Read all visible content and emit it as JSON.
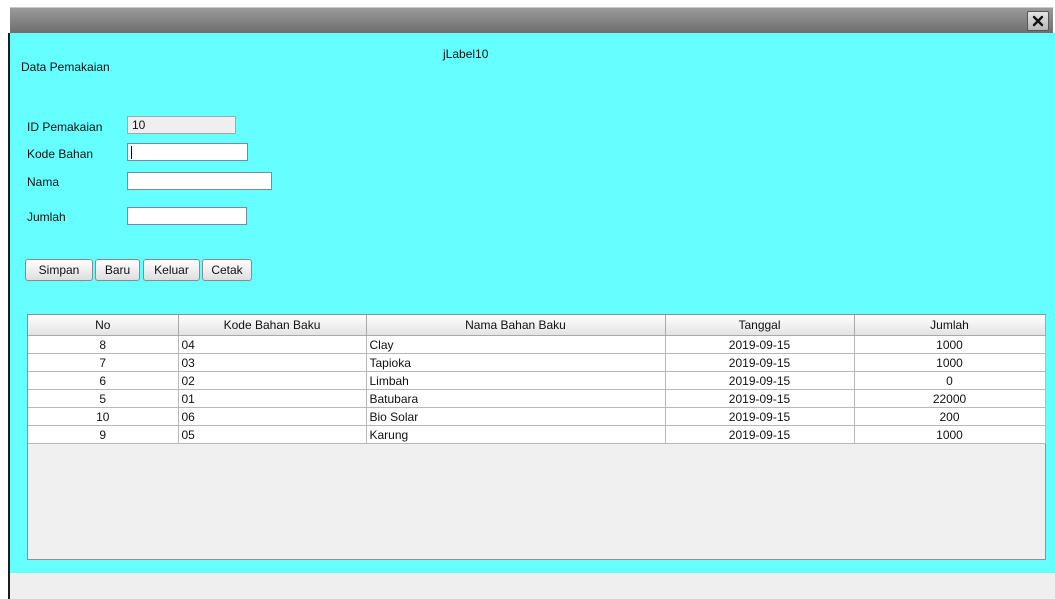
{
  "window": {
    "close_icon": "close-icon"
  },
  "header": {
    "title": "Data Pemakaian",
    "top_label": "jLabel10"
  },
  "form": {
    "id_label": "ID Pemakaian",
    "id_value": "10",
    "kode_label": "Kode Bahan",
    "kode_value": "",
    "nama_label": "Nama",
    "nama_value": "",
    "jumlah_label": "Jumlah",
    "jumlah_value": ""
  },
  "buttons": {
    "simpan": "Simpan",
    "baru": "Baru",
    "keluar": "Keluar",
    "cetak": "Cetak"
  },
  "table": {
    "columns": [
      "No",
      "Kode Bahan Baku",
      "Nama Bahan Baku",
      "Tanggal",
      "Jumlah"
    ],
    "rows": [
      [
        "8",
        "04",
        "Clay",
        "2019-09-15",
        "1000"
      ],
      [
        "7",
        "03",
        "Tapioka",
        "2019-09-15",
        "1000"
      ],
      [
        "6",
        "02",
        "Limbah",
        "2019-09-15",
        "0"
      ],
      [
        "5",
        "01",
        "Batubara",
        "2019-09-15",
        "22000"
      ],
      [
        "10",
        "06",
        "Bio Solar",
        "2019-09-15",
        "200"
      ],
      [
        "9",
        "05",
        "Karung",
        "2019-09-15",
        "1000"
      ]
    ]
  },
  "colors": {
    "panel_bg": "#66ffff",
    "titlebar": "#7a7a7a"
  }
}
